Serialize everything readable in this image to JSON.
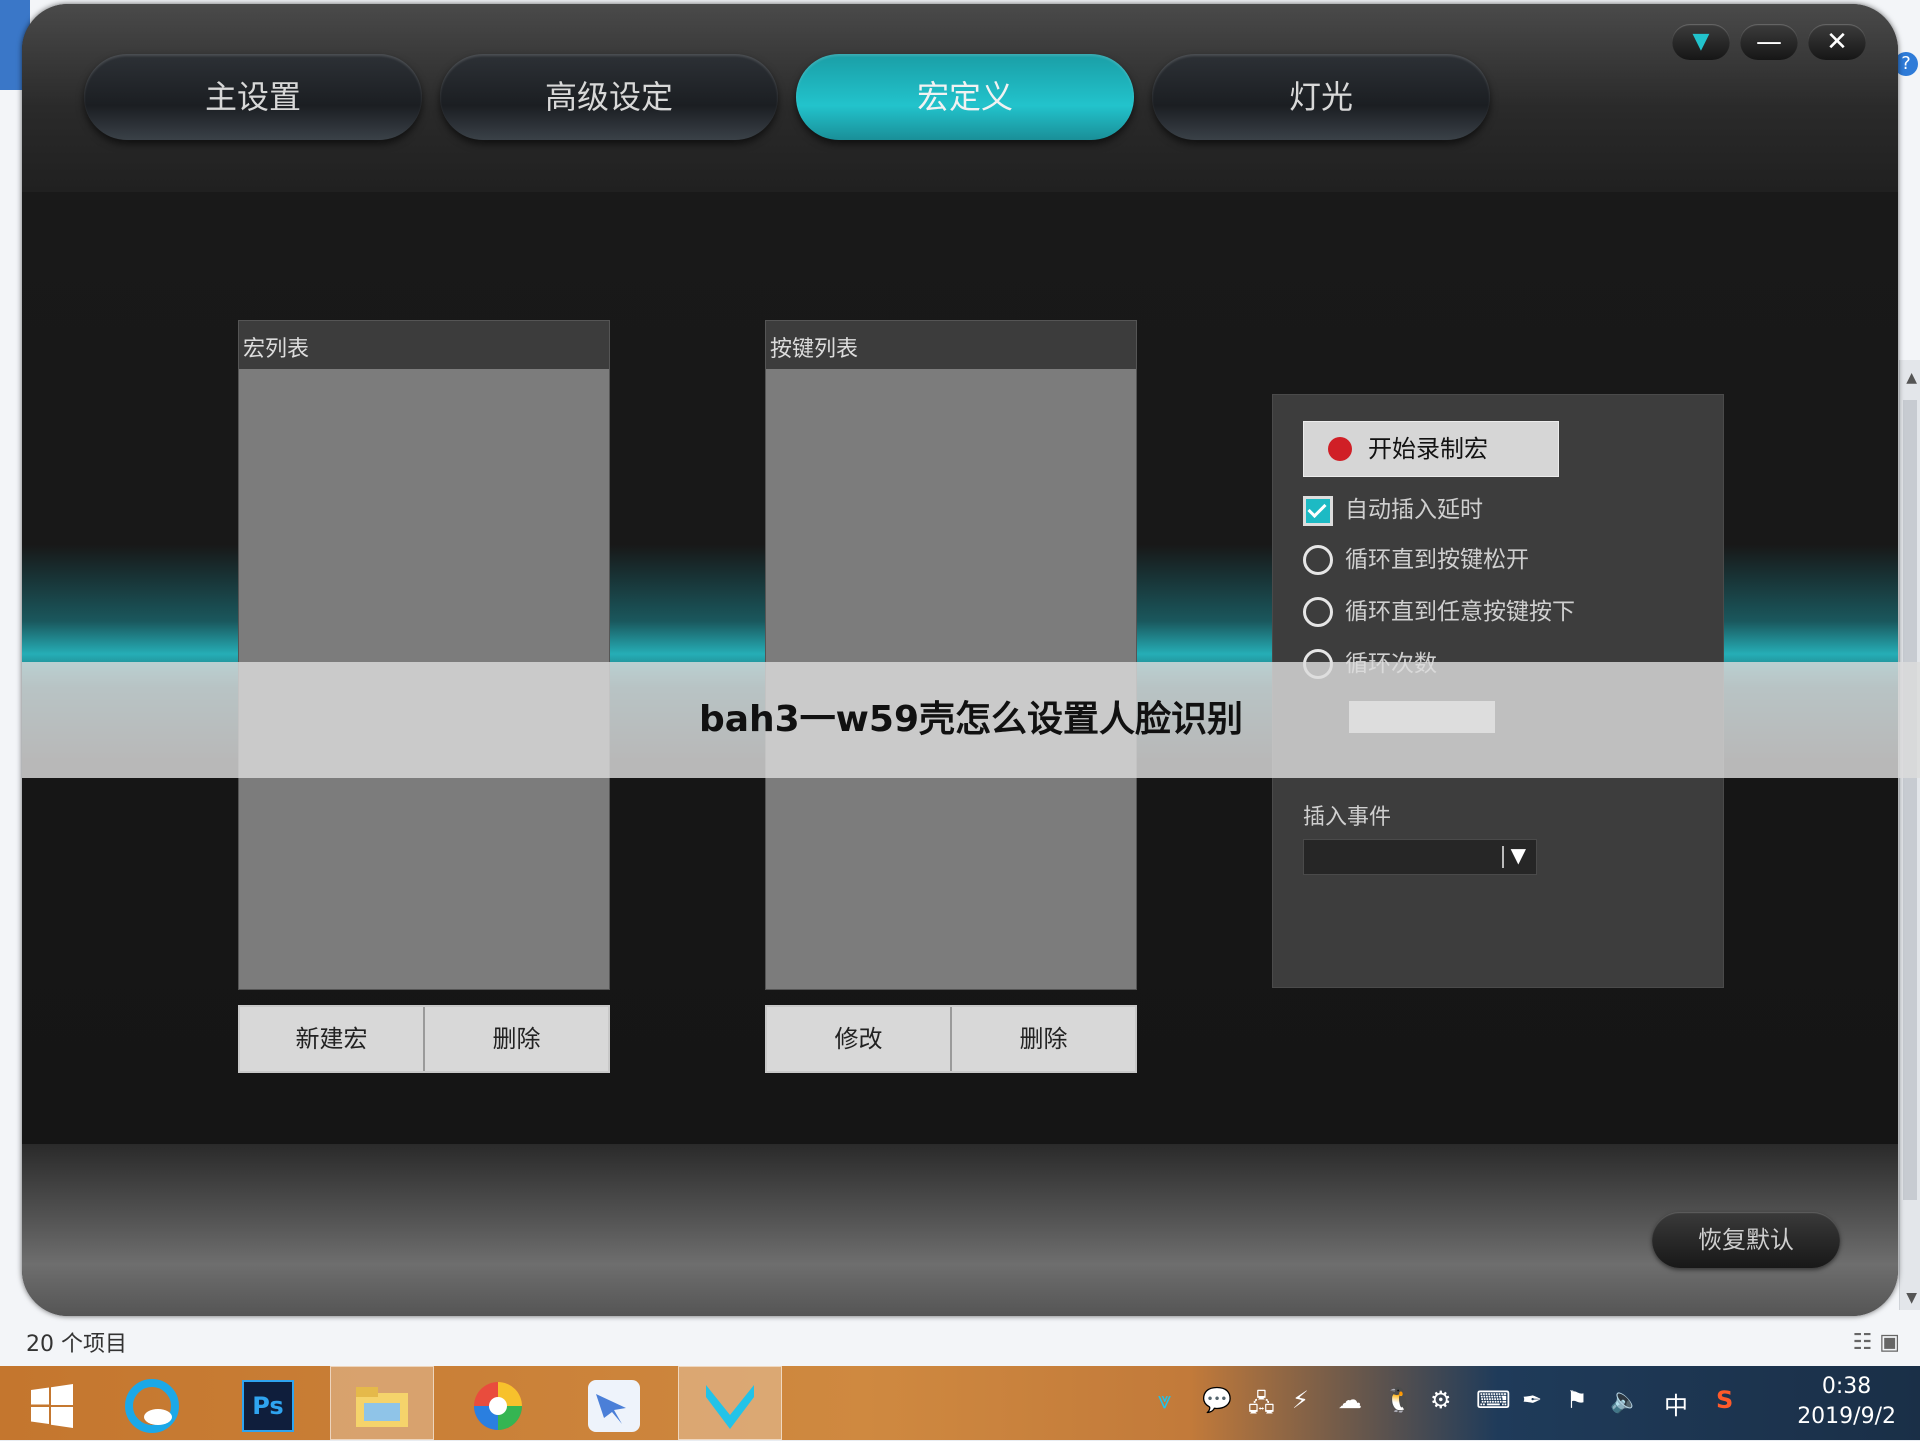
{
  "app": {
    "tabs": [
      {
        "label": "主设置"
      },
      {
        "label": "高级设定"
      },
      {
        "label": "宏定义"
      },
      {
        "label": "灯光"
      }
    ],
    "active_tab_index": 2,
    "accent_color": "#22c3cc",
    "window_controls": {
      "menu_icon": "triangle-down-icon",
      "minimize_icon": "minimize-icon",
      "close_icon": "close-icon"
    }
  },
  "macro_list": {
    "title": "宏列表",
    "new_label": "新建宏",
    "delete_label": "删除"
  },
  "key_list": {
    "title": "按键列表",
    "edit_label": "修改",
    "delete_label": "删除"
  },
  "options": {
    "record_label": "开始录制宏",
    "record_color": "#d01f26",
    "auto_delay_label": "自动插入延时",
    "auto_delay_checked": true,
    "loop_release_label": "循环直到按键松开",
    "loop_any_label": "循环直到任意按键按下",
    "loop_count_label": "循环次数",
    "loop_count_value": "",
    "insert_event_label": "插入事件",
    "insert_event_value": ""
  },
  "footer": {
    "reset_label": "恢复默认"
  },
  "overlay": {
    "title": "bah3一w59壳怎么设置人脸识别"
  },
  "explorer": {
    "status": "20 个项目"
  },
  "taskbar": {
    "items": [
      "windows-start-icon",
      "browser-icon",
      "photoshop-icon",
      "file-explorer-icon",
      "color-wheel-app-icon",
      "feishu-bird-icon",
      "mouse-driver-icon"
    ],
    "ps_label": "Ps",
    "tray_icons": [
      "mouse-driver-tray-icon",
      "wechat-icon",
      "network-icon",
      "usb-icon",
      "cloud-icon",
      "qq-icon",
      "settings-icon",
      "ime-icon",
      "pen-icon",
      "flag-icon",
      "volume-icon",
      "sogou-icon"
    ],
    "ime_label": "中",
    "sogou_label": "S",
    "time": "0:38",
    "date": "2019/9/2"
  }
}
